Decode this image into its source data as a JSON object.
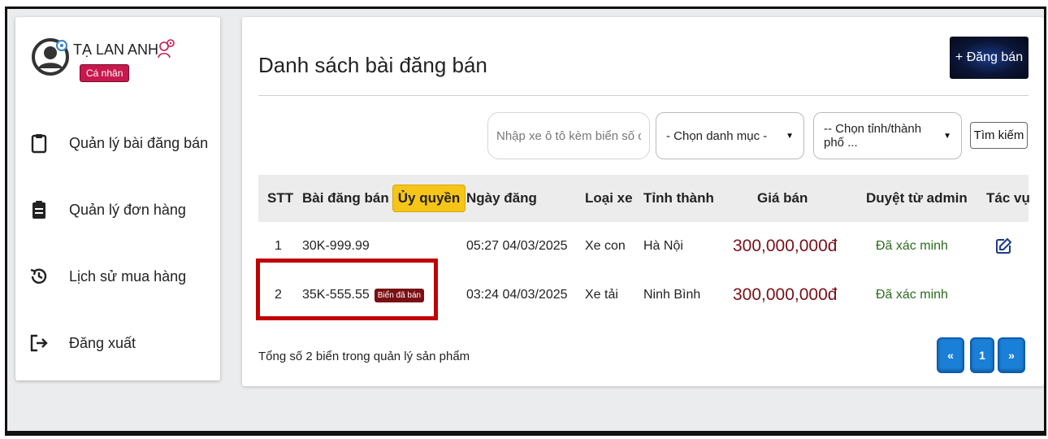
{
  "user": {
    "name": "TẠ LAN ANH",
    "role": "Cá nhân"
  },
  "sidebar": {
    "items": [
      {
        "label": "Quản lý bài đăng bán",
        "icon": "clipboard-icon"
      },
      {
        "label": "Quản lý đơn hàng",
        "icon": "clipboard-list-icon"
      },
      {
        "label": "Lịch sử mua hàng",
        "icon": "history-icon"
      },
      {
        "label": "Đăng xuất",
        "icon": "logout-icon"
      }
    ]
  },
  "main": {
    "title": "Danh sách bài đăng bán",
    "new_post_label": "+ Đăng bán",
    "search": {
      "placeholder": "Nhập xe ô tô kèm biển số cần tìm",
      "category": "- Chọn danh mục -",
      "province": "-- Chọn tỉnh/thành phố ...",
      "button": "Tìm kiếm"
    },
    "table": {
      "headers": {
        "stt": "STT",
        "post": "Bài đăng bán",
        "authorized": "Ủy quyền",
        "date": "Ngày đăng",
        "vehicle_type": "Loại xe",
        "province": "Tỉnh thành",
        "price": "Giá bán",
        "approval": "Duyệt từ admin",
        "actions": "Tác vụ"
      },
      "rows": [
        {
          "stt": "1",
          "plate": "30K-999.99",
          "badge": "",
          "date": "05:27 04/03/2025",
          "vehicle_type": "Xe con",
          "province": "Hà Nội",
          "price": "300,000,000đ",
          "approval": "Đã xác minh"
        },
        {
          "stt": "2",
          "plate": "35K-555.55",
          "badge": "Biển đã bán",
          "date": "03:24 04/03/2025",
          "vehicle_type": "Xe tải",
          "province": "Ninh Bình",
          "price": "300,000,000đ",
          "approval": "Đã xác minh"
        }
      ]
    },
    "total_text": "Tổng số 2 biển trong quản lý sản phẩm",
    "pagination": {
      "prev": "«",
      "page": "1",
      "next": "»"
    }
  },
  "colors": {
    "role_badge": "#c8194f",
    "authorized_tag": "#f5c518",
    "price": "#7a1018",
    "approved": "#2e6b1f",
    "sold_badge": "#7a0f14",
    "pagination": "#1a7fd6",
    "highlight_box": "#c00000"
  }
}
